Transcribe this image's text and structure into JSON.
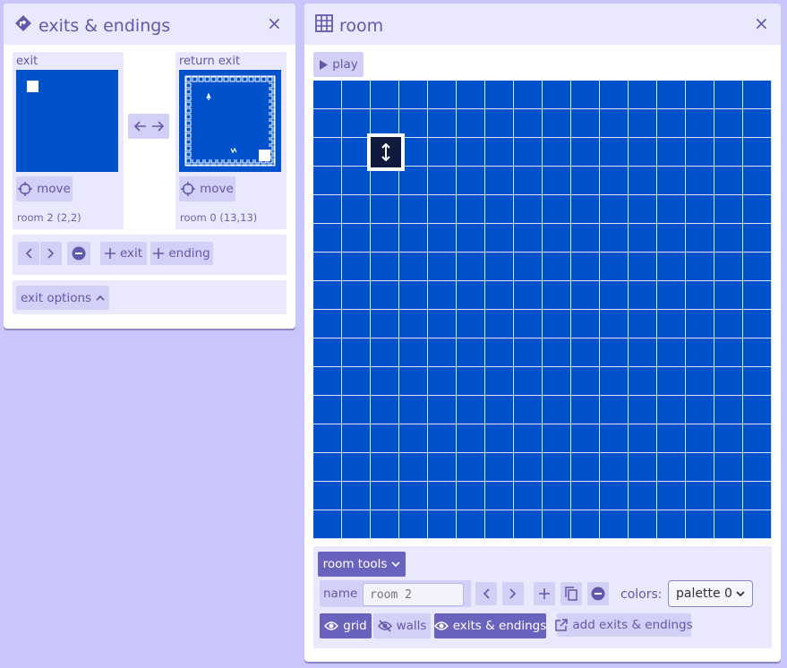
{
  "exits_panel": {
    "title": "exits & endings",
    "close": "×",
    "exit_label": "exit",
    "return_label": "return exit",
    "move_label": "move",
    "exit_room": "room 2 (2,2)",
    "return_room": "room 0 (13,13)",
    "exit_button": "exit",
    "ending_button": "ending",
    "options_label": "exit options"
  },
  "room_panel": {
    "title": "room",
    "close": "×",
    "play_label": "play",
    "tools_label": "room tools",
    "name_label": "name",
    "name_placeholder": "room 2",
    "colors_label": "colors:",
    "palette_value": "palette 0",
    "grid_label": "grid",
    "walls_label": "walls",
    "exits_toggle_label": "exits & endings",
    "add_exits_label": "add exits & endings"
  },
  "colors": {
    "background": "#c8c6fa",
    "room_blue": "#0052cc",
    "accent": "#6a63bd"
  }
}
